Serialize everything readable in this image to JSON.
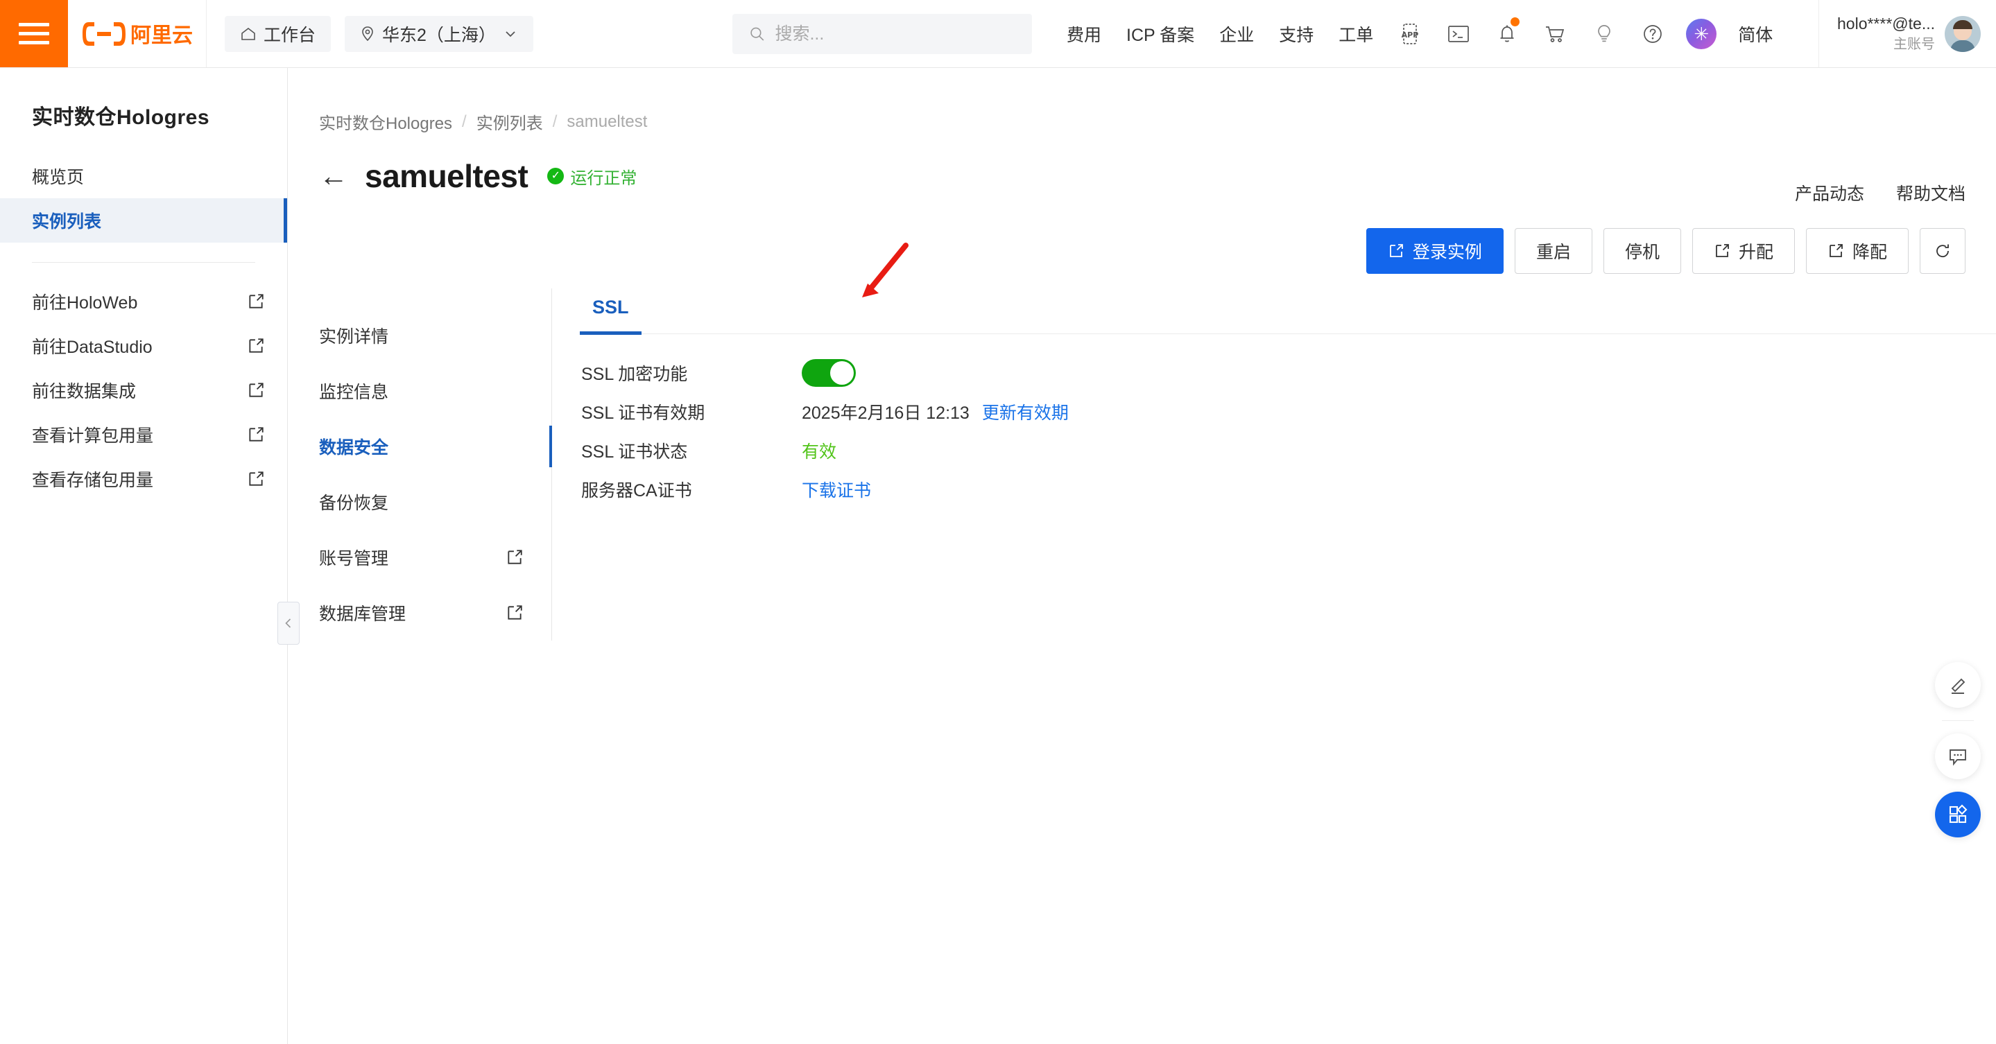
{
  "colors": {
    "brand_orange": "#ff6a00",
    "primary_blue": "#1366ec",
    "active_blue": "#1a5fbd",
    "link_blue": "#1a73e8",
    "status_green": "#33b233",
    "toggle_green": "#0fa50f",
    "annotation_red": "#e81c13"
  },
  "header": {
    "menu_icon": "hamburger-icon",
    "logo_text": "阿里云",
    "workbench": {
      "label": "工作台",
      "icon": "home-icon"
    },
    "region": {
      "label": "华东2（上海）",
      "icon": "location-pin-icon",
      "caret": "chevron-down-icon"
    },
    "search": {
      "value": "",
      "placeholder": "搜索..."
    },
    "nav_links": [
      "费用",
      "ICP 备案",
      "企业",
      "支持",
      "工单"
    ],
    "icons": [
      {
        "name": "app-icon",
        "label": "APP"
      },
      {
        "name": "terminal-icon",
        "label": ""
      },
      {
        "name": "bell-icon",
        "label": "",
        "badge": true
      },
      {
        "name": "cart-icon",
        "label": ""
      },
      {
        "name": "bulb-icon",
        "label": ""
      },
      {
        "name": "help-circle-icon",
        "label": ""
      }
    ],
    "ai_assistant": {
      "name": "ai-sparkle-icon",
      "glyph": "✳"
    },
    "language": "简体",
    "account": {
      "name": "holo****@te...",
      "role": "主账号"
    }
  },
  "sidebar": {
    "title": "实时数仓Hologres",
    "items": [
      {
        "label": "概览页",
        "active": false,
        "external": false
      },
      {
        "label": "实例列表",
        "active": true,
        "external": false
      }
    ],
    "external_items": [
      {
        "label": "前往HoloWeb",
        "external": true
      },
      {
        "label": "前往DataStudio",
        "external": true
      },
      {
        "label": "前往数据集成",
        "external": true
      },
      {
        "label": "查看计算包用量",
        "external": true
      },
      {
        "label": "查看存储包用量",
        "external": true
      }
    ]
  },
  "main": {
    "breadcrumb": [
      {
        "label": "实时数仓Hologres",
        "current": false
      },
      {
        "label": "实例列表",
        "current": false
      },
      {
        "label": "samueltest",
        "current": true
      }
    ],
    "breadcrumb_separator": "/",
    "header_links": [
      "产品动态",
      "帮助文档"
    ],
    "back_arrow": "←",
    "page_title": "samueltest",
    "status": {
      "text": "运行正常",
      "icon": "check-circle-icon"
    },
    "actions": [
      {
        "label": "登录实例",
        "style": "primary",
        "icon": "external-link-icon"
      },
      {
        "label": "重启",
        "style": "default",
        "icon": ""
      },
      {
        "label": "停机",
        "style": "default",
        "icon": ""
      },
      {
        "label": "升配",
        "style": "default",
        "icon": "external-link-icon"
      },
      {
        "label": "降配",
        "style": "default",
        "icon": "external-link-icon"
      },
      {
        "label": "",
        "style": "icon-only",
        "icon": "refresh-icon"
      }
    ],
    "inner_nav": [
      {
        "label": "实例详情",
        "active": false,
        "external": false
      },
      {
        "label": "监控信息",
        "active": false,
        "external": false
      },
      {
        "label": "数据安全",
        "active": true,
        "external": false
      },
      {
        "label": "备份恢复",
        "active": false,
        "external": false
      },
      {
        "label": "账号管理",
        "active": false,
        "external": true
      },
      {
        "label": "数据库管理",
        "active": false,
        "external": true
      }
    ],
    "collapse_handle_icon": "chevron-left-icon",
    "tabs": [
      {
        "label": "SSL",
        "active": true
      }
    ],
    "fields": [
      {
        "label": "SSL 加密功能",
        "type": "toggle",
        "value": "on"
      },
      {
        "label": "SSL 证书有效期",
        "type": "text-link",
        "value": "2025年2月16日 12:13",
        "link": "更新有效期"
      },
      {
        "label": "SSL 证书状态",
        "type": "status",
        "value": "有效"
      },
      {
        "label": "服务器CA证书",
        "type": "link",
        "link": "下载证书"
      }
    ]
  },
  "fabs": [
    {
      "name": "pencil-feedback-icon",
      "style": "white"
    },
    {
      "name": "chat-bubble-icon",
      "style": "white"
    },
    {
      "name": "apps-grid-icon",
      "style": "blue"
    }
  ],
  "annotation": {
    "type": "arrow",
    "color": "#e81c13",
    "points_at": "ssl-toggle"
  }
}
